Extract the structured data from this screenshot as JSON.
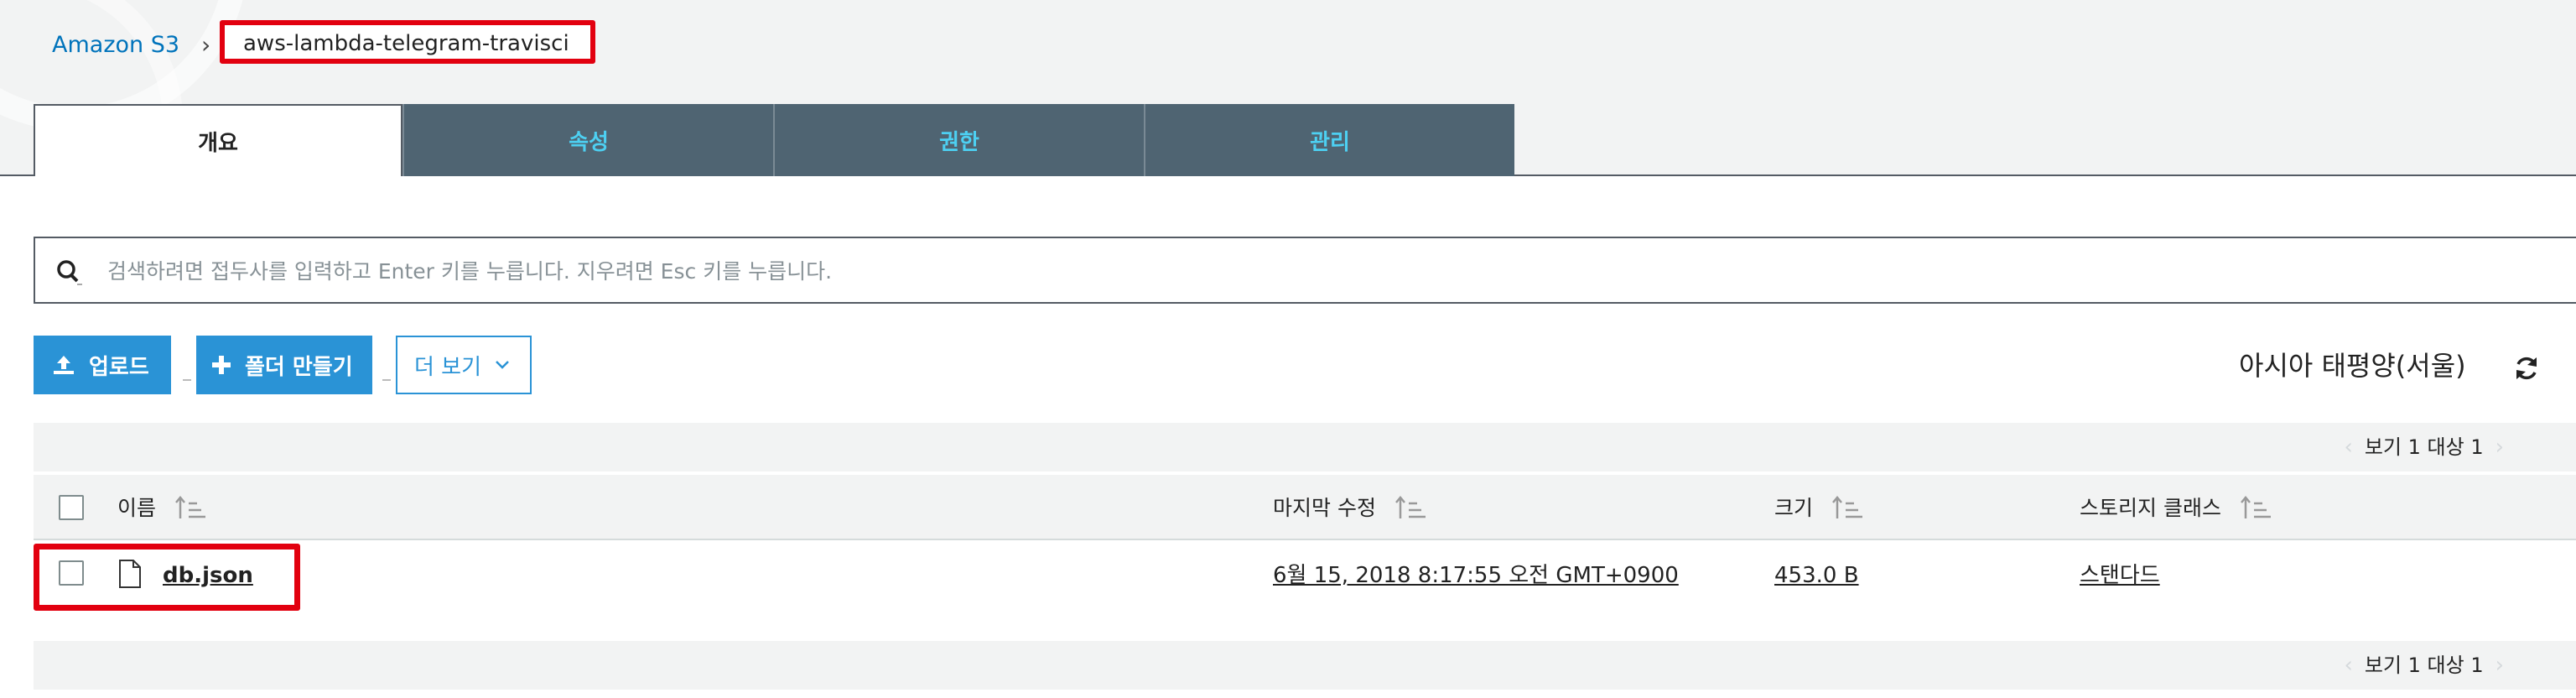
{
  "breadcrumb": {
    "root": "Amazon S3",
    "separator": "›",
    "current": "aws-lambda-telegram-travisci"
  },
  "tabs": [
    {
      "label": "개요",
      "active": true
    },
    {
      "label": "속성",
      "active": false
    },
    {
      "label": "권한",
      "active": false
    },
    {
      "label": "관리",
      "active": false
    }
  ],
  "search": {
    "placeholder": "검색하려면 접두사를 입력하고 Enter 키를 누릅니다. 지우려면 Esc 키를 누릅니다."
  },
  "toolbar": {
    "upload_label": "업로드",
    "create_folder_label": "폴더 만들기",
    "more_label": "더 보기",
    "region": "아시아 태평양(서울)"
  },
  "pager": {
    "text": "보기 1 대상 1"
  },
  "table": {
    "columns": [
      "이름",
      "마지막 수정",
      "크기",
      "스토리지 클래스"
    ],
    "rows": [
      {
        "name": "db.json",
        "last_modified": "6월 15, 2018 8:17:55 오전 GMT+0900",
        "size": "453.0 B",
        "storage_class": "스탠다드"
      }
    ]
  },
  "colors": {
    "accent": "#2a93d6",
    "link": "#0073bb",
    "tab_inactive_bg": "#4f6472",
    "tab_inactive_text": "#4dd0f2",
    "highlight": "#e2000f"
  }
}
